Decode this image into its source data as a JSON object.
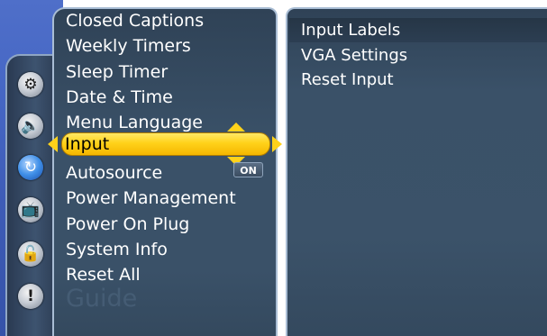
{
  "menu": {
    "items": [
      "Closed Captions",
      "Weekly Timers",
      "Sleep Timer",
      "Date & Time",
      "Menu Language",
      "Input",
      "Autosource",
      "Power Management",
      "Power On Plug",
      "System Info",
      "Reset All"
    ],
    "selected": "Input",
    "ghost_label": "Guide",
    "autosource_status": "ON"
  },
  "rail": {
    "icons": [
      "gear-icon",
      "speaker-icon",
      "input-icon",
      "tv-icon",
      "lock-icon",
      "exclamation-icon"
    ],
    "active": "input-icon"
  },
  "submenu": {
    "items": [
      "Input Labels",
      "VGA Settings",
      "Reset Input"
    ]
  },
  "colors": {
    "highlight": "#ffd21a",
    "panel": "#3a5168",
    "backdrop": "#4566c4"
  }
}
